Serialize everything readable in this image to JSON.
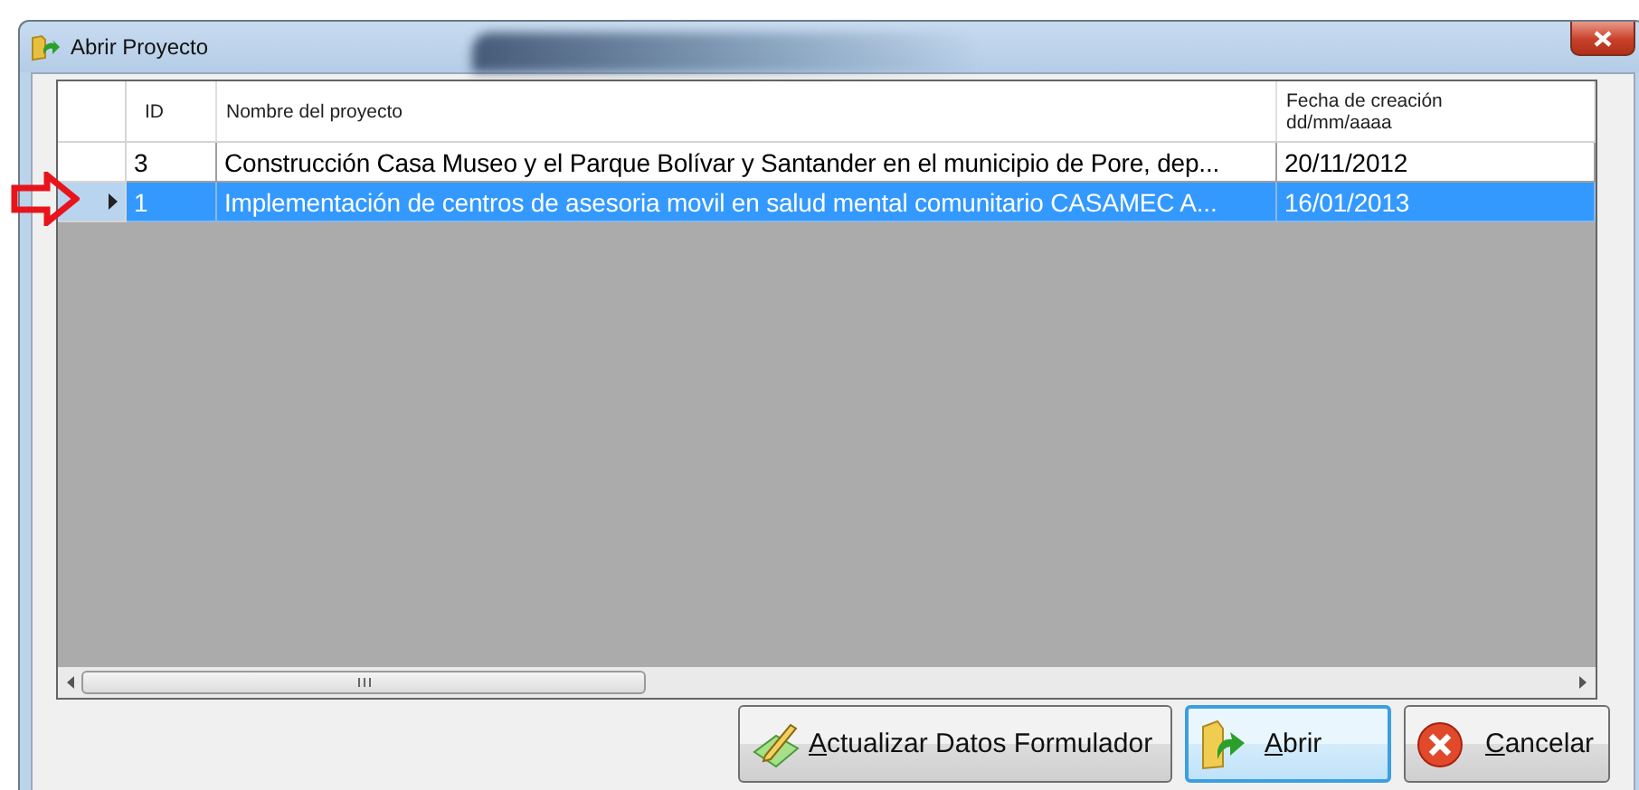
{
  "window": {
    "title": "Abrir Proyecto"
  },
  "table": {
    "columns": [
      "ID",
      "Nombre del proyecto",
      "Fecha de creación\ndd/mm/aaaa"
    ],
    "rows": [
      {
        "cells": [
          "3",
          "Construcción Casa Museo y el Parque Bolívar y Santander en el municipio de Pore, dep...",
          "20/11/2012"
        ],
        "selected": false
      },
      {
        "cells": [
          "1",
          "Implementación de centros de asesoria movil en salud mental comunitario CASAMEC A...",
          "16/01/2013"
        ],
        "selected": true
      }
    ]
  },
  "buttons": [
    {
      "label": "Actualizar Datos Formulador",
      "kind": "update",
      "default": false
    },
    {
      "label": "Abrir",
      "kind": "open",
      "default": true
    },
    {
      "label": "Cancelar",
      "kind": "cancel",
      "default": false
    }
  ]
}
